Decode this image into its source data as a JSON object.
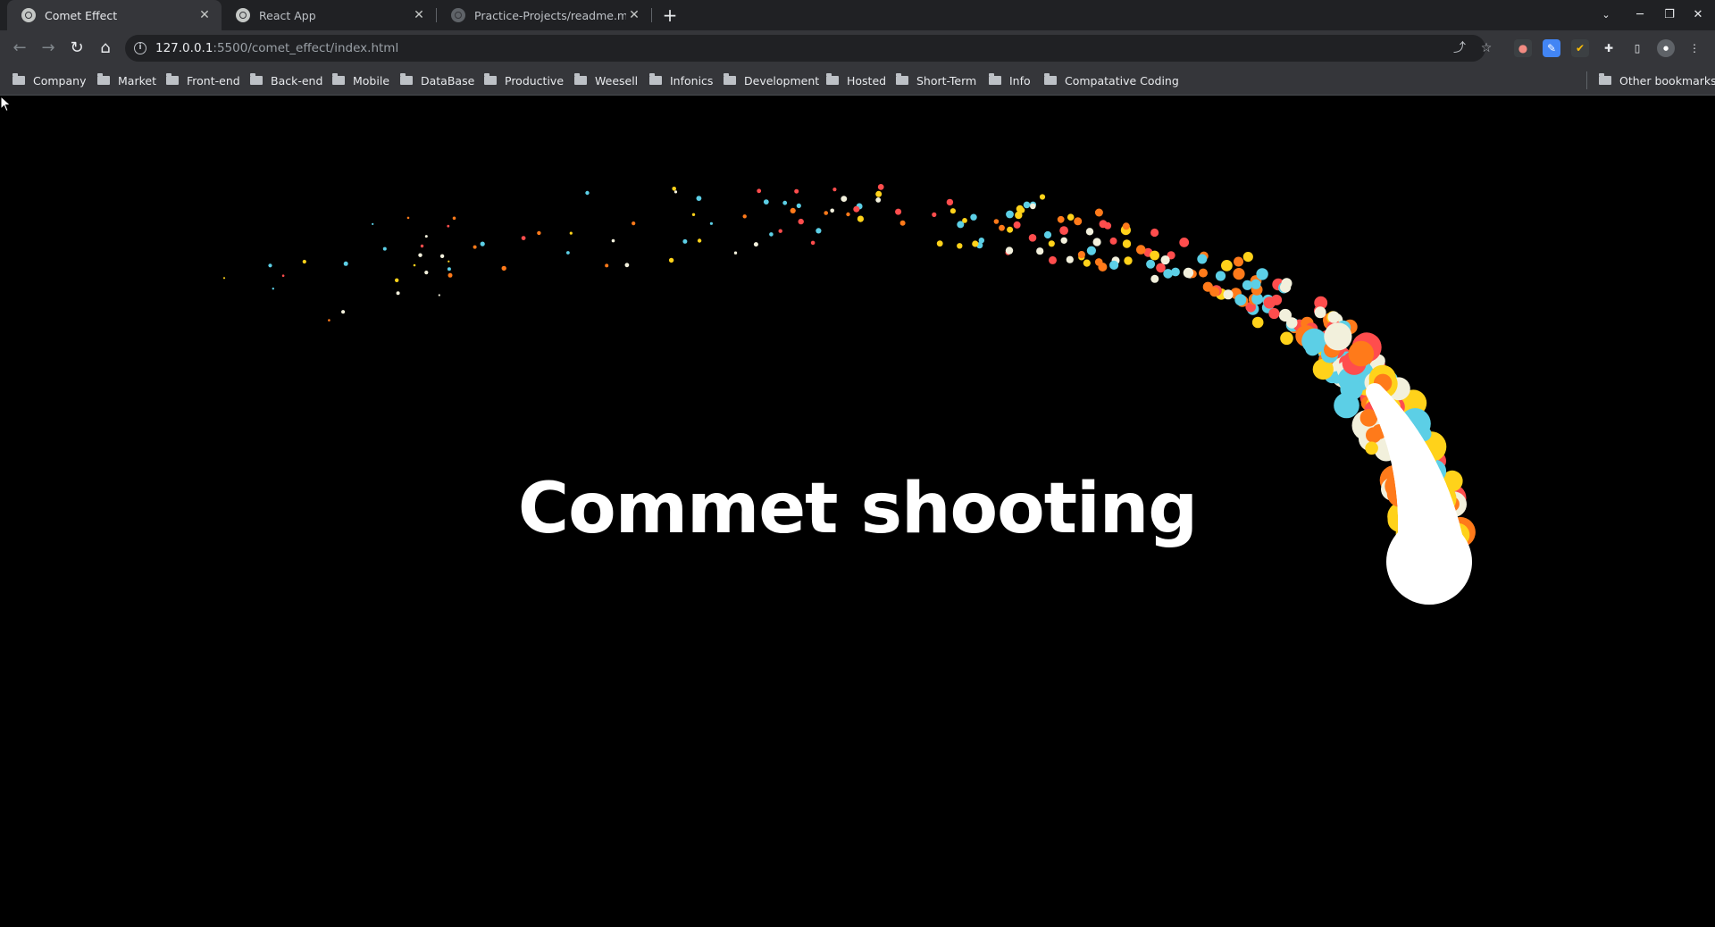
{
  "browser": {
    "tabs": [
      {
        "title": "Comet Effect",
        "active": true,
        "favicon": "globe-icon"
      },
      {
        "title": "React App",
        "active": false,
        "favicon": "globe-icon"
      },
      {
        "title": "Practice-Projects/readme.md a",
        "active": false,
        "favicon": "github-icon"
      }
    ],
    "url": {
      "host": "127.0.0.1",
      "path": ":5500/comet_effect/index.html"
    },
    "bookmarks": [
      "Company",
      "Market",
      "Front-end",
      "Back-end",
      "Mobile",
      "DataBase",
      "Productive",
      "Weesell",
      "Infonics",
      "Development",
      "Hosted",
      "Short-Term",
      "Info",
      "Compatative Coding"
    ],
    "other_bookmarks": "Other bookmarks"
  },
  "page": {
    "headline": "Commet shooting",
    "particle_colors": [
      "#ffffff",
      "#ff7a1a",
      "#ffd21a",
      "#5ccfe6",
      "#ff4d4d",
      "#f2f0dc"
    ]
  }
}
